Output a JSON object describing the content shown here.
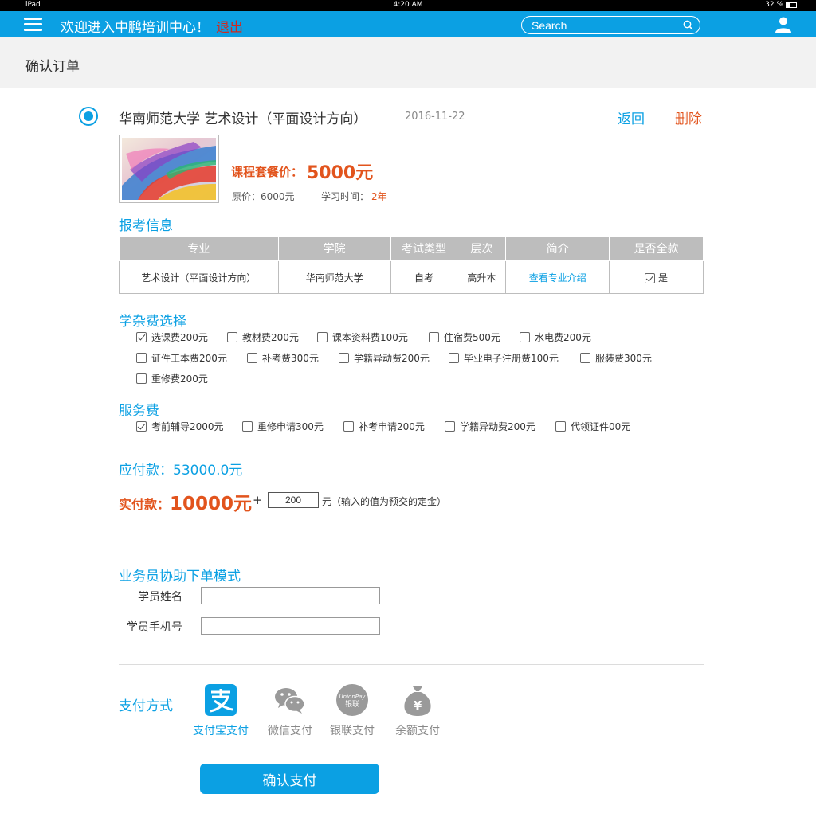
{
  "status_bar": {
    "device": "iPad",
    "time": "4:20 AM",
    "battery": "32 %"
  },
  "navbar": {
    "title": "欢迎进入中鹏培训中心！",
    "logout": "退出",
    "search_placeholder": "Search"
  },
  "page": {
    "title": "确认订单"
  },
  "course": {
    "name": "华南师范大学  艺术设计（平面设计方向）",
    "date": "2016-11-22",
    "back": "返回",
    "delete": "删除",
    "package_label": "课程套餐价：",
    "package_price": "5000元",
    "original_price": "原价：6000元",
    "study_time_label": "学习时间：",
    "study_time_value": "2年"
  },
  "exam_info": {
    "title": "报考信息",
    "columns": [
      "专业",
      "学院",
      "考试类型",
      "层次",
      "简介",
      "是否全款"
    ],
    "row": {
      "major": "艺术设计（平面设计方向）",
      "college": "华南师范大学",
      "exam_type": "自考",
      "level": "高升本",
      "intro": "查看专业介绍",
      "full_payment": "是"
    }
  },
  "misc_fees": {
    "title": "学杂费选择",
    "options": [
      {
        "label": "选课费200元",
        "checked": true
      },
      {
        "label": "教材费200元",
        "checked": false
      },
      {
        "label": "课本资料费100元",
        "checked": false
      },
      {
        "label": "住宿费500元",
        "checked": false
      },
      {
        "label": "水电费200元",
        "checked": false
      },
      {
        "label": "证件工本费200元",
        "checked": false
      },
      {
        "label": "补考费300元",
        "checked": false
      },
      {
        "label": "学籍异动费200元",
        "checked": false
      },
      {
        "label": "毕业电子注册费100元",
        "checked": false
      },
      {
        "label": "服装费300元",
        "checked": false
      },
      {
        "label": "重修费200元",
        "checked": false
      }
    ]
  },
  "service_fees": {
    "title": "服务费",
    "options": [
      {
        "label": "考前辅导2000元",
        "checked": true
      },
      {
        "label": "重修申请300元",
        "checked": false
      },
      {
        "label": "补考申请200元",
        "checked": false
      },
      {
        "label": "学籍异动费200元",
        "checked": false
      },
      {
        "label": "代领证件00元",
        "checked": false
      }
    ]
  },
  "payment": {
    "payable": "应付款：53000.0元",
    "actual_label": "实付款：",
    "actual_value": "10000元",
    "plus": "+",
    "deposit_value": "200",
    "deposit_note": "元（输入的值为预交的定金）"
  },
  "salesperson": {
    "title": "业务员协助下单模式",
    "student_name_label": "学员姓名",
    "student_phone_label": "学员手机号",
    "student_name_value": "",
    "student_phone_value": ""
  },
  "pay_methods": {
    "title": "支付方式",
    "options": [
      {
        "label": "支付宝支付",
        "icon": "alipay-icon",
        "active": true
      },
      {
        "label": "微信支付",
        "icon": "wechat-icon",
        "active": false
      },
      {
        "label": "银联支付",
        "icon": "unionpay-icon",
        "active": false
      },
      {
        "label": "余额支付",
        "icon": "balance-icon",
        "active": false
      }
    ],
    "unionpay_text": "UnionPay",
    "unionpay_cn": "银联",
    "balance_symbol": "¥"
  },
  "confirm_button": "确认支付",
  "colors": {
    "brand": "#0ba0e3",
    "accent": "#e2541d",
    "header_bg": "#f2f2f2"
  }
}
